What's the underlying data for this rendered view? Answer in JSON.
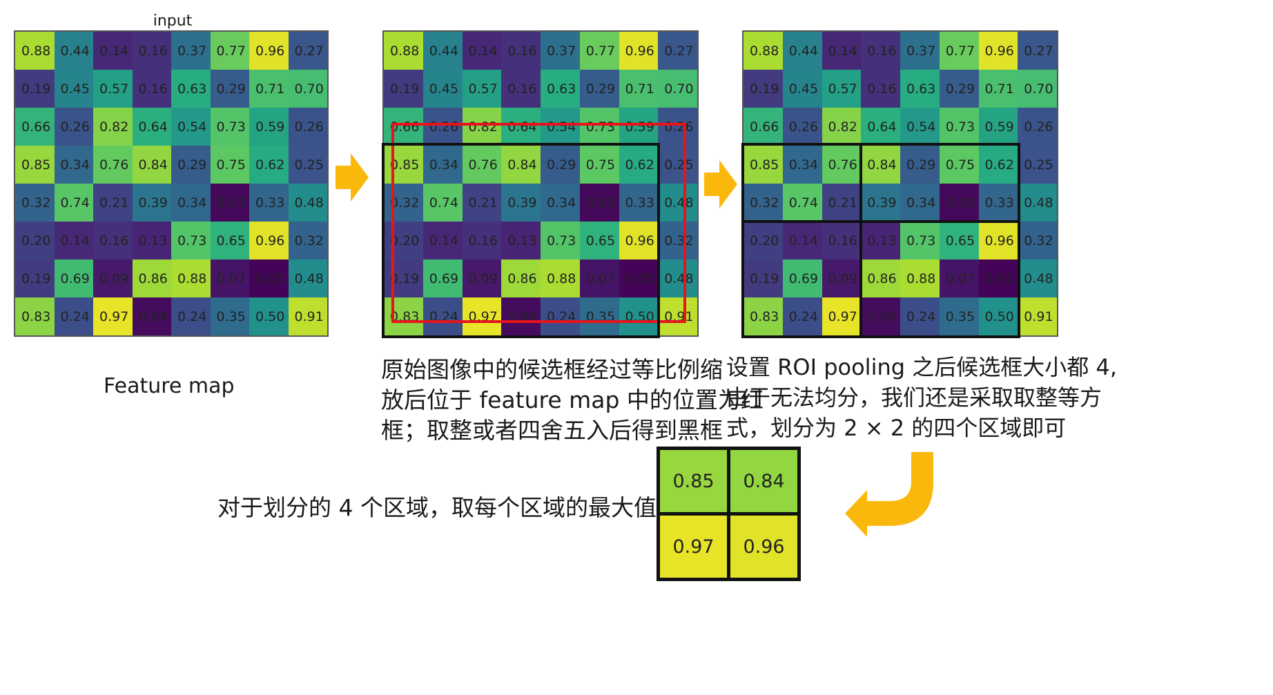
{
  "colors": {
    "arrow": "#FBB80C",
    "red_box": "#E8141C",
    "black_box": "#111111"
  },
  "panel1": {
    "title": "input"
  },
  "matrix": [
    [
      "0.88",
      "0.44",
      "0.14",
      "0.16",
      "0.37",
      "0.77",
      "0.96",
      "0.27"
    ],
    [
      "0.19",
      "0.45",
      "0.57",
      "0.16",
      "0.63",
      "0.29",
      "0.71",
      "0.70"
    ],
    [
      "0.66",
      "0.26",
      "0.82",
      "0.64",
      "0.54",
      "0.73",
      "0.59",
      "0.26"
    ],
    [
      "0.85",
      "0.34",
      "0.76",
      "0.84",
      "0.29",
      "0.75",
      "0.62",
      "0.25"
    ],
    [
      "0.32",
      "0.74",
      "0.21",
      "0.39",
      "0.34",
      "0.03",
      "0.33",
      "0.48"
    ],
    [
      "0.20",
      "0.14",
      "0.16",
      "0.13",
      "0.73",
      "0.65",
      "0.96",
      "0.32"
    ],
    [
      "0.19",
      "0.69",
      "0.09",
      "0.86",
      "0.88",
      "0.07",
      "0.01",
      "0.48"
    ],
    [
      "0.83",
      "0.24",
      "0.97",
      "0.04",
      "0.24",
      "0.35",
      "0.50",
      "0.91"
    ]
  ],
  "captions": {
    "feature_map": "Feature map",
    "step2": [
      "原始图像中的候选框经过等比例缩",
      "放后位于 feature map 中的位置为红",
      "框；取整或者四舍五入后得到黑框"
    ],
    "step3": [
      "设置 ROI pooling 之后候选框大小都 4,",
      "由于无法均分，我们还是采取取整等方",
      "式，划分为 2 × 2 的四个区域即可"
    ],
    "step4": "对于划分的 4 个区域，取每个区域的最大值"
  },
  "result": {
    "values": [
      "0.85",
      "0.84",
      "0.97",
      "0.96"
    ]
  }
}
